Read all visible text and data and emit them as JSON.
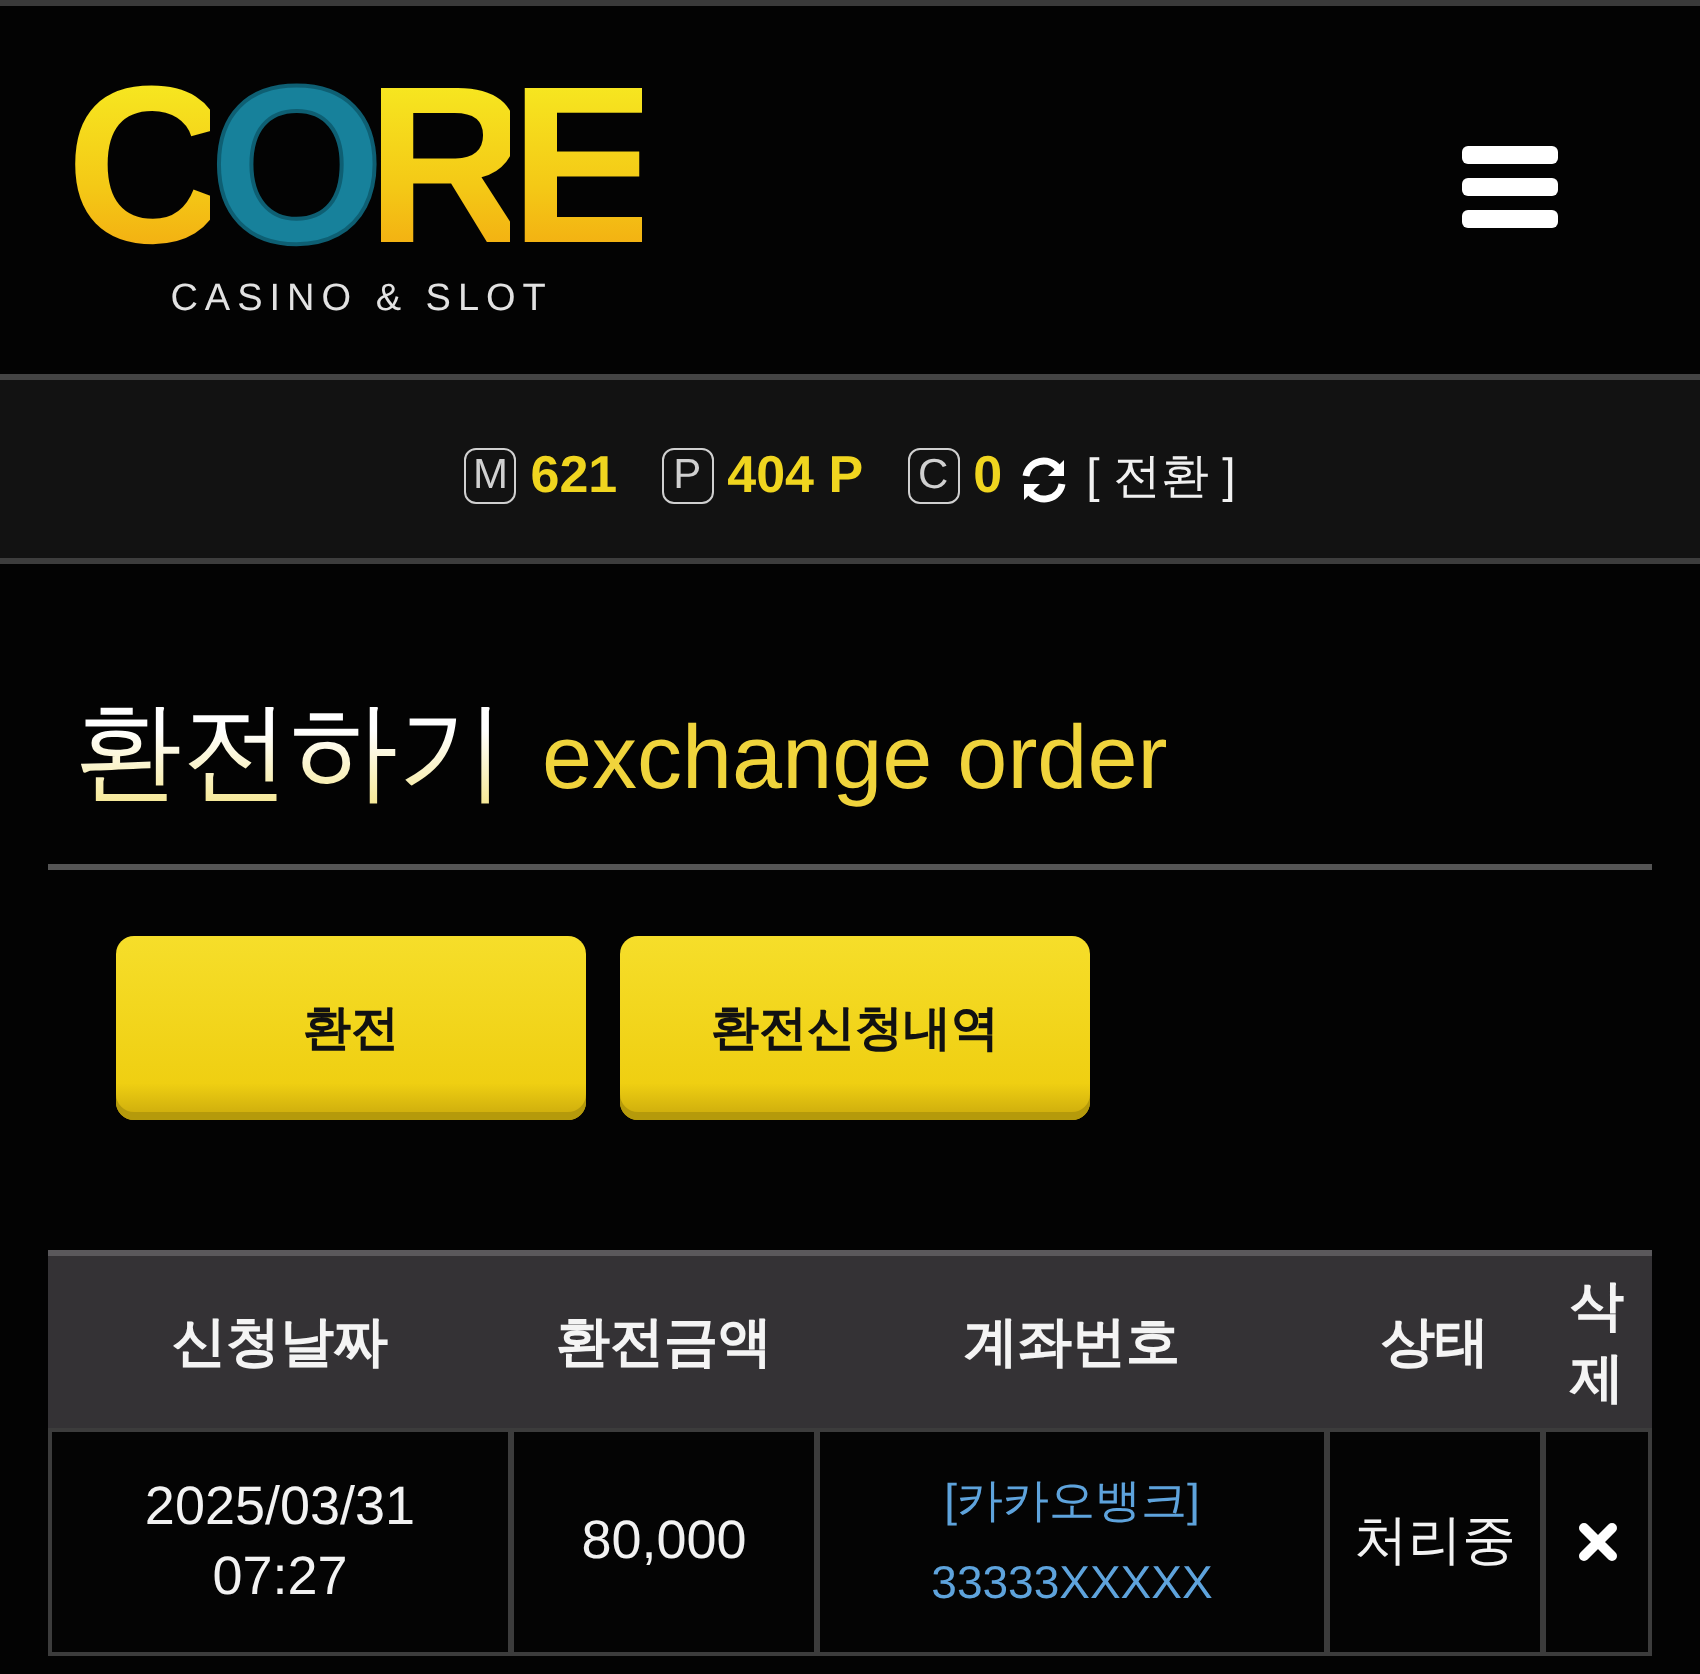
{
  "header": {
    "logo": {
      "wordmark": "CORE",
      "tagline": "CASINO & SLOT"
    }
  },
  "balance_bar": {
    "items": [
      {
        "badge": "M",
        "value": "621"
      },
      {
        "badge": "P",
        "value": "404 P"
      },
      {
        "badge": "C",
        "value": "0"
      }
    ],
    "switch_link": "[ 전환 ]"
  },
  "page_title": {
    "title": "환전하기",
    "subtitle": "exchange order"
  },
  "buttons": [
    {
      "label": "환전"
    },
    {
      "label": "환전신청내역"
    }
  ],
  "table": {
    "columns": [
      "신청날짜",
      "환전금액",
      "계좌번호",
      "상태",
      "삭제"
    ],
    "rows": [
      {
        "date": "2025/03/31",
        "time": "07:27",
        "amount": "80,000",
        "bank": "[카카오뱅크]",
        "account": "33333XXXXX",
        "status": "처리중"
      }
    ]
  }
}
